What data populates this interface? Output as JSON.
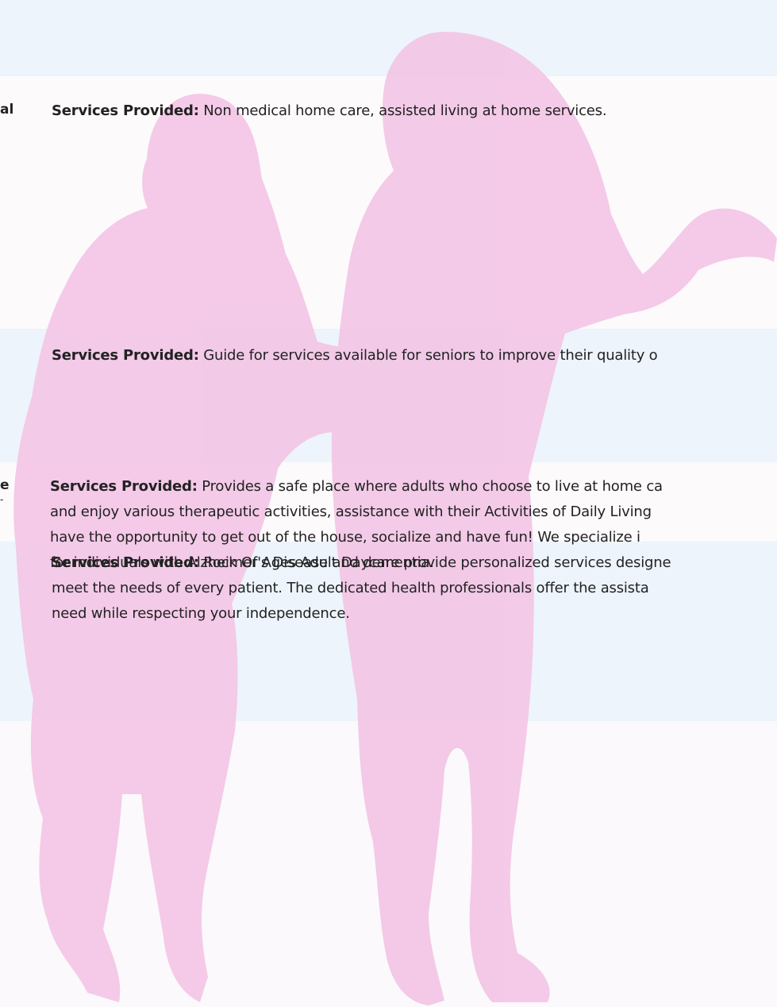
{
  "entries": [
    {
      "cut_label": "al",
      "label": "Services Provided:",
      "lines": [
        "Non medical home care, assisted living at home services."
      ]
    },
    {
      "cut_label": "",
      "label": "Services Provided:",
      "lines": [
        " Guide for services available for seniors to improve their quality o"
      ]
    },
    {
      "cut_label": "e",
      "cut_label_2": "-",
      "label": "Services Provided:",
      "lines": [
        " Provides a safe place where adults who choose to live at home ca",
        "and enjoy various therapeutic activities, assistance with their Activities of Daily Living",
        "have the opportunity to get out of the house, socialize and have fun!  We specialize i",
        "for individuals with Alzheimer's Disease and dementia."
      ]
    },
    {
      "cut_label": "",
      "label": "Services Provided:",
      "lines": [
        "Rock Of Ages Adult Daycare provide personalized services designe",
        "meet the needs of every patient. The dedicated health professionals offer the assista",
        "need while respecting your independence."
      ]
    }
  ],
  "colors": {
    "silhouette": "#f3c6e6",
    "band_blue": "#edf4fb",
    "band_white": "#fdfafc"
  }
}
